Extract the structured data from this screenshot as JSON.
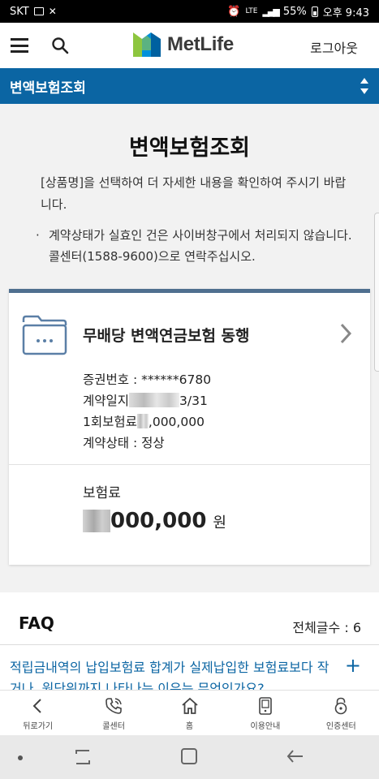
{
  "status_bar": {
    "carrier": "SKT",
    "network": "LTE",
    "battery": "55%",
    "time": "오후 9:43"
  },
  "header": {
    "logo_text": "MetLife",
    "logout_label": "로그아웃"
  },
  "menubar": {
    "label": "변액보험조회"
  },
  "page": {
    "title": "변액보험조회",
    "description": "[상품명]을 선택하여 더 자세한 내용을 확인하여 주시기 바랍니다.",
    "notice": "계약상태가 실효인 건은 사이버창구에서 처리되지 않습니다. 콜센터(1588-9600)으로 연락주십시오."
  },
  "card": {
    "product_name": "무배당 변액연금보험 동행",
    "cert_label": "증권번호 : ",
    "cert_value": "******6780",
    "contract_date_label": "계약일지",
    "contract_date_value": "3/31",
    "first_premium_label": "1회보험료",
    "first_premium_value": ",000,000",
    "status_label": "계약상태 : ",
    "status_value": "정상",
    "premium_label": "보험료",
    "premium_value": "000,000",
    "premium_unit": "원"
  },
  "faq": {
    "title": "FAQ",
    "count_label": "전체글수 : ",
    "count_value": "6",
    "question": "적립금내역의 납입보험료 합계가 실제납입한 보험료보다 작거나, 원단위까지 나타나는 이유는 무엇인가요?",
    "expand_symbol": "+"
  },
  "bottom_nav": [
    {
      "label": "뒤로가기",
      "icon": "back-arrow-icon"
    },
    {
      "label": "콜센터",
      "icon": "phone-icon"
    },
    {
      "label": "홈",
      "icon": "home-icon"
    },
    {
      "label": "이용안내",
      "icon": "guide-icon"
    },
    {
      "label": "인증센터",
      "icon": "lock-icon"
    }
  ],
  "colors": {
    "brand_blue": "#0b65a3",
    "card_top": "#4f6f8f",
    "logo_green": "#8dc63f",
    "logo_blue": "#0090da"
  }
}
